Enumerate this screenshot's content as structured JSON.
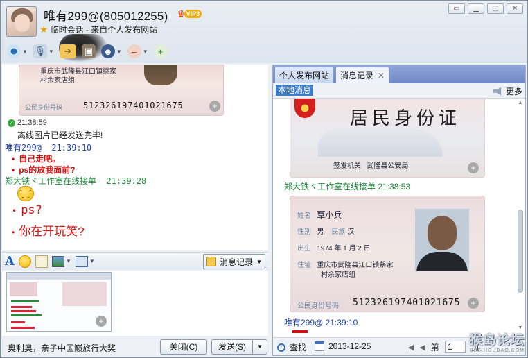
{
  "header": {
    "name": "唯有299@(805012255)",
    "vip_badge": "VIP3",
    "subtitle": "临时会话 - 来自个人发布网站"
  },
  "window_buttons": [
    "▢",
    "▁",
    "▢",
    "✕"
  ],
  "toolbar": {
    "items": [
      "video-call",
      "voice-call",
      "send-file",
      "remote-assist",
      "security",
      "remove-user",
      "add-friend"
    ]
  },
  "chat": {
    "card_top": {
      "address_line1": "重庆市武隆县江口镇蔡家",
      "address_line2": "村余家店组",
      "id_label": "公民身份号码",
      "id_number": "512326197401021675"
    },
    "messages": [
      {
        "type": "system",
        "time": "21:38:59",
        "text": "离线图片已经发送完毕!"
      },
      {
        "type": "sender",
        "name": "唯有299@",
        "time": "21:39:10"
      },
      {
        "type": "text",
        "lines": [
          "自己走吧。",
          "ps的放我面前?"
        ]
      },
      {
        "type": "sender",
        "name": "郑大铁ヾ工作室在线接单",
        "time": "21:39:28"
      },
      {
        "type": "emoji",
        "name": "sweat-face"
      },
      {
        "type": "text_large",
        "lines": [
          "ps?",
          "你在开玩笑?"
        ]
      }
    ]
  },
  "input_toolbar": {
    "history_button": "消息记录"
  },
  "bottom": {
    "ad_text": "奥利奥，亲子中国巅旅行大奖",
    "close_button": "关闭(C)",
    "send_button": "发送(S)"
  },
  "right_panel": {
    "tabs": [
      {
        "label": "个人发布网站",
        "active": false
      },
      {
        "label": "消息记录",
        "active": true,
        "closable": true
      }
    ],
    "local_tag": "本地消息",
    "more_label": "更多",
    "card_front": {
      "title": "居民身份证",
      "issuer_label": "签发机关",
      "issuer": "武隆县公安局"
    },
    "sender1": {
      "name": "郑大铁ヾ工作室在线接单",
      "time": "21:38:53"
    },
    "card_back": {
      "name_label": "姓名",
      "name": "覃小兵",
      "sex_label": "性别",
      "sex": "男",
      "ethnic_label": "民族",
      "ethnic": "汉",
      "birth_label": "出生",
      "birth": "1974 年 1 月 2 日",
      "address_label": "住址",
      "address_line1": "重庆市武隆县江口镇蔡家",
      "address_line2": "村余家店组",
      "id_label": "公民身份号码",
      "id_number": "512326197401021675"
    },
    "sender2": {
      "name": "唯有299@",
      "time": "21:39:10"
    },
    "bottom": {
      "search_label": "查找",
      "date": "2013-12-25",
      "page_prefix": "第",
      "page_value": "1",
      "page_suffix": "页"
    }
  },
  "watermark": {
    "big": "猴岛论坛",
    "small": "BBS.HOUDAO.COM"
  }
}
